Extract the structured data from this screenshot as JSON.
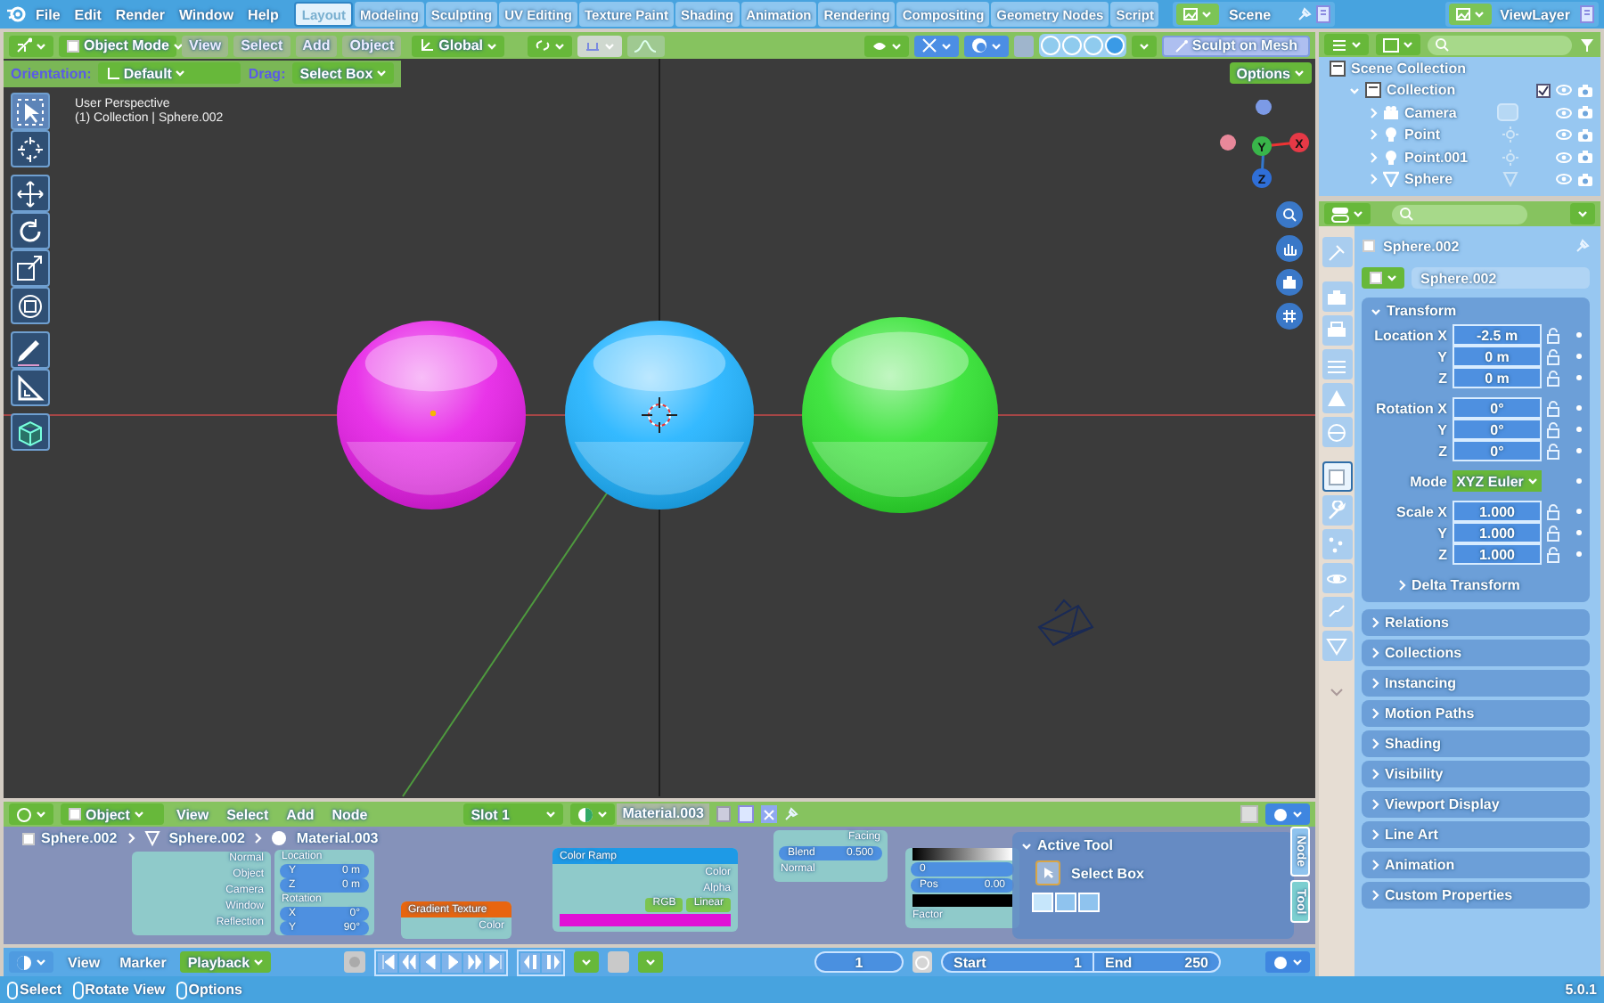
{
  "topbar": {
    "menus": [
      "File",
      "Edit",
      "Render",
      "Window",
      "Help"
    ],
    "workspaces": [
      {
        "label": "Layout",
        "selected": true
      },
      {
        "label": "Modeling",
        "selected": false
      },
      {
        "label": "Sculpting",
        "selected": false
      },
      {
        "label": "UV Editing",
        "selected": false
      },
      {
        "label": "Texture Paint",
        "selected": false
      },
      {
        "label": "Shading",
        "selected": false
      },
      {
        "label": "Animation",
        "selected": false
      },
      {
        "label": "Rendering",
        "selected": false
      },
      {
        "label": "Compositing",
        "selected": false
      },
      {
        "label": "Geometry Nodes",
        "selected": false
      },
      {
        "label": "Script",
        "selected": false
      }
    ],
    "scene": "Scene",
    "view_layer": "ViewLayer"
  },
  "viewport": {
    "mode": "Object Mode",
    "menus": [
      "View",
      "Select",
      "Add",
      "Object"
    ],
    "orientation": "Global",
    "sculpt_button": "Sculpt on Mesh",
    "orientation_label": "Orientation:",
    "transform_orientation": "Default",
    "drag_label": "Drag:",
    "drag_tool": "Select Box",
    "options": "Options",
    "proportional_editing": false,
    "info": [
      "User Perspective",
      "(1) Collection | Sphere.002"
    ],
    "shading_modes": [
      {
        "selected": false
      },
      {
        "selected": false
      },
      {
        "selected": false
      },
      {
        "selected": true
      }
    ],
    "tools": [
      {
        "kind": "select",
        "selected": true
      },
      {
        "kind": "cursor",
        "selected": false
      },
      {
        "kind": "move",
        "selected": false
      },
      {
        "kind": "rotate",
        "selected": false
      },
      {
        "kind": "scale",
        "selected": false
      },
      {
        "kind": "transform",
        "selected": false
      },
      {
        "kind": "annotate",
        "selected": false
      },
      {
        "kind": "measure",
        "selected": false
      },
      {
        "kind": "add-cube",
        "selected": false
      }
    ],
    "gizmo_axes": [
      "Y",
      "X",
      "Z"
    ],
    "spheres": [
      {
        "color": "#e61ee6"
      },
      {
        "color": "#1eb2ff"
      },
      {
        "color": "#2ee22e"
      }
    ]
  },
  "node_editor": {
    "editor": "Object",
    "menus": [
      "View",
      "Select",
      "Add",
      "Node"
    ],
    "slot": "Slot 1",
    "material": "Material.003",
    "breadcrumbs": [
      "Sphere.002",
      "Sphere.002",
      "Material.003"
    ],
    "nodes": [
      {
        "rows": [
          {
            "kind": "output",
            "text": "Normal"
          },
          {
            "kind": "output",
            "text": "Object"
          },
          {
            "kind": "output",
            "text": "Camera"
          },
          {
            "kind": "output",
            "text": "Window"
          },
          {
            "kind": "output",
            "text": "Reflection"
          }
        ]
      },
      {
        "rows": [
          {
            "kind": "label",
            "text": "Location"
          },
          {
            "kind": "field",
            "label": "Y",
            "value": "0 m"
          },
          {
            "kind": "field",
            "label": "Z",
            "value": "0 m"
          },
          {
            "kind": "label",
            "text": "Rotation"
          },
          {
            "kind": "field",
            "label": "X",
            "value": "0°"
          },
          {
            "kind": "field",
            "label": "Y",
            "value": "90°"
          }
        ]
      },
      {
        "title": "Gradient Texture",
        "color": "#e8650f",
        "rows": [
          {
            "kind": "output",
            "text": "Color"
          }
        ]
      },
      {
        "title": "Color Ramp",
        "color": "#1e9ae6",
        "rows": [
          {
            "kind": "output",
            "text": "Color"
          },
          {
            "kind": "output",
            "text": "Alpha"
          },
          {
            "kind": "dropdowns",
            "values": [
              "RGB",
              "Linear"
            ]
          },
          {
            "kind": "ramp",
            "color": "#e010d6"
          }
        ]
      },
      {
        "rows": [
          {
            "kind": "output",
            "text": "Facing"
          },
          {
            "kind": "field",
            "label": "Blend",
            "value": "0.500"
          },
          {
            "kind": "input",
            "text": "Normal"
          }
        ]
      },
      {
        "rows": [
          {
            "kind": "gradient"
          },
          {
            "kind": "field",
            "label": "0",
            "value": ""
          },
          {
            "kind": "field",
            "label": "Pos",
            "value": "0.00"
          },
          {
            "kind": "ramp",
            "color": "#000000"
          },
          {
            "kind": "input",
            "text": "Factor"
          }
        ]
      }
    ],
    "active_tool": {
      "title": "Active Tool",
      "tool": "Select Box"
    },
    "sidebar_tabs": [
      {
        "label": "Node",
        "selected": false
      },
      {
        "label": "Tool",
        "selected": true
      }
    ]
  },
  "timeline": {
    "menus": [
      "View",
      "Marker"
    ],
    "playback": "Playback",
    "current_frame": "1",
    "start_label": "Start",
    "start": "1",
    "end_label": "End",
    "end": "250"
  },
  "status_bar": {
    "hints": [
      "Select",
      "Rotate View",
      "Options"
    ],
    "version": "5.0.1"
  },
  "outliner": {
    "items": [
      {
        "label": "Scene Collection",
        "kind": "scene-collection",
        "children": [
          {
            "label": "Collection",
            "kind": "collection",
            "checked": true,
            "children": [
              {
                "label": "Camera",
                "kind": "camera"
              },
              {
                "label": "Point",
                "kind": "light"
              },
              {
                "label": "Point.001",
                "kind": "light"
              },
              {
                "label": "Sphere",
                "kind": "mesh"
              }
            ]
          }
        ]
      }
    ]
  },
  "properties": {
    "object": "Sphere.002",
    "object_name": "Sphere.002",
    "tabs": [
      {
        "kind": "tool",
        "selected": false
      },
      {
        "kind": "render",
        "selected": false
      },
      {
        "kind": "output",
        "selected": false
      },
      {
        "kind": "view-layer",
        "selected": false
      },
      {
        "kind": "scene",
        "selected": false
      },
      {
        "kind": "world",
        "selected": false
      },
      {
        "kind": "object",
        "selected": true
      },
      {
        "kind": "modifier",
        "selected": false
      },
      {
        "kind": "particles",
        "selected": false
      },
      {
        "kind": "physics",
        "selected": false
      },
      {
        "kind": "constraints",
        "selected": false
      },
      {
        "kind": "data",
        "selected": false
      },
      {
        "kind": "more",
        "selected": false
      }
    ],
    "transform": {
      "title": "Transform",
      "expanded": true,
      "groups": [
        {
          "rows": [
            {
              "kind": "field",
              "label": "Location X",
              "value": "-2.5 m"
            },
            {
              "kind": "field",
              "label": "Y",
              "value": "0 m"
            },
            {
              "kind": "field",
              "label": "Z",
              "value": "0 m"
            }
          ]
        },
        {
          "rows": [
            {
              "kind": "field",
              "label": "Rotation X",
              "value": "0°"
            },
            {
              "kind": "field",
              "label": "Y",
              "value": "0°"
            },
            {
              "kind": "field",
              "label": "Z",
              "value": "0°"
            }
          ]
        },
        {
          "rows": [
            {
              "kind": "dropdown",
              "label": "Mode",
              "value": "XYZ Euler"
            }
          ]
        },
        {
          "rows": [
            {
              "kind": "field",
              "label": "Scale X",
              "value": "1.000"
            },
            {
              "kind": "field",
              "label": "Y",
              "value": "1.000"
            },
            {
              "kind": "field",
              "label": "Z",
              "value": "1.000"
            }
          ]
        }
      ],
      "subpanel": "Delta Transform"
    },
    "panels": [
      "Relations",
      "Collections",
      "Instancing",
      "Motion Paths",
      "Shading",
      "Visibility",
      "Viewport Display",
      "Line Art",
      "Animation",
      "Custom Properties"
    ]
  }
}
